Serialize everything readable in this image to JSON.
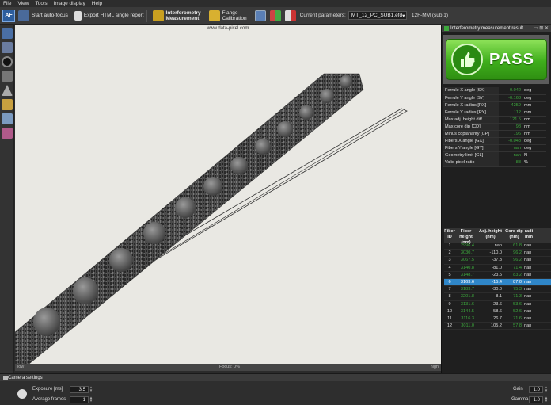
{
  "menu": [
    "File",
    "View",
    "Tools",
    "Image display",
    "Help"
  ],
  "toolbar": {
    "af_label": "AF",
    "auto_focus": "Start auto-focus",
    "export_html": "Export HTML single report",
    "interferometry_1": "Interferometry",
    "interferometry_2": "Measurement",
    "flange_1": "Flange",
    "flange_2": "Calibration",
    "current_params_label": "Current parameters:",
    "current_params_value": "MT_12_PC_SUB1.efd",
    "mode_label": "12F-MM (sub 1)"
  },
  "viewport": {
    "watermark": "www.data-pixel.com",
    "bar_left": "low",
    "bar_center": "Focus: 0%",
    "bar_right": "high"
  },
  "result_panel": {
    "title": "Interferometry measurement result",
    "controls": "▭ ⊠ ✕",
    "status": "PASS",
    "params": [
      {
        "label": "Ferrule X angle [SX]",
        "value": "-0.042",
        "unit": "deg"
      },
      {
        "label": "Ferrule Y angle [SY]",
        "value": "-0.168",
        "unit": "deg"
      },
      {
        "label": "Ferrule X radius [RX]",
        "value": "4259",
        "unit": "mm"
      },
      {
        "label": "Ferrule Y radius [RY]",
        "value": "112",
        "unit": "mm"
      },
      {
        "label": "Max adj. height diff.",
        "value": "121.5",
        "unit": "nm"
      },
      {
        "label": "Max core dip [CD]",
        "value": "98",
        "unit": "nm"
      },
      {
        "label": "Minus coplanarity [CP]",
        "value": "196",
        "unit": "nm"
      },
      {
        "label": "Fibers X angle [GX]",
        "value": "-0.048",
        "unit": "deg"
      },
      {
        "label": "Fibers Y angle [GY]",
        "value": "nan",
        "unit": "deg"
      },
      {
        "label": "Geometry limit [GL]",
        "value": "nan",
        "unit": "N"
      },
      {
        "label": "Valid pixel ratio",
        "value": "88",
        "unit": "%"
      }
    ]
  },
  "fiber_table": {
    "headers": [
      "Fiber ID",
      "Fiber height (nm)",
      "Adj. height (nm)",
      "Core dip (nm)",
      "radi mm"
    ],
    "rows": [
      {
        "id": "1",
        "h": "2996.4",
        "adj": "nan",
        "dip": "61.8",
        "r": "nan"
      },
      {
        "id": "2",
        "h": "3030.7",
        "adj": "-110.0",
        "dip": "96.2",
        "r": "nan"
      },
      {
        "id": "3",
        "h": "3067.5",
        "adj": "-37.3",
        "dip": "96.2",
        "r": "nan"
      },
      {
        "id": "4",
        "h": "3140.8",
        "adj": "-81.0",
        "dip": "71.4",
        "r": "nan"
      },
      {
        "id": "5",
        "h": "3148.7",
        "adj": "-23.5",
        "dip": "83.2",
        "r": "nan"
      },
      {
        "id": "6",
        "h": "3163.6",
        "adj": "-15.4",
        "dip": "87.0",
        "r": "nan",
        "selected": true
      },
      {
        "id": "7",
        "h": "3183.7",
        "adj": "-30.0",
        "dip": "75.3",
        "r": "nan"
      },
      {
        "id": "8",
        "h": "3201.8",
        "adj": "-8.1",
        "dip": "71.3",
        "r": "nan"
      },
      {
        "id": "9",
        "h": "3131.6",
        "adj": "23.6",
        "dip": "53.6",
        "r": "nan"
      },
      {
        "id": "10",
        "h": "3144.5",
        "adj": "-58.6",
        "dip": "52.6",
        "r": "nan"
      },
      {
        "id": "11",
        "h": "3116.3",
        "adj": "26.7",
        "dip": "71.6",
        "r": "nan"
      },
      {
        "id": "12",
        "h": "3011.0",
        "adj": "105.2",
        "dip": "57.8",
        "r": "nan"
      }
    ]
  },
  "camera": {
    "title": "Camera settings",
    "exposure_label": "Exposure [ms]",
    "exposure_value": "3.5",
    "avg_frames_label": "Average frames",
    "avg_frames_value": "1",
    "gain_label": "Gain",
    "gain_value": "1.0",
    "gamma_label": "Gamma",
    "gamma_value": "1.0"
  },
  "colors": {
    "pass_green": "#3fae1c",
    "value_green": "#3da83d",
    "selection_blue": "#2f86c8"
  }
}
